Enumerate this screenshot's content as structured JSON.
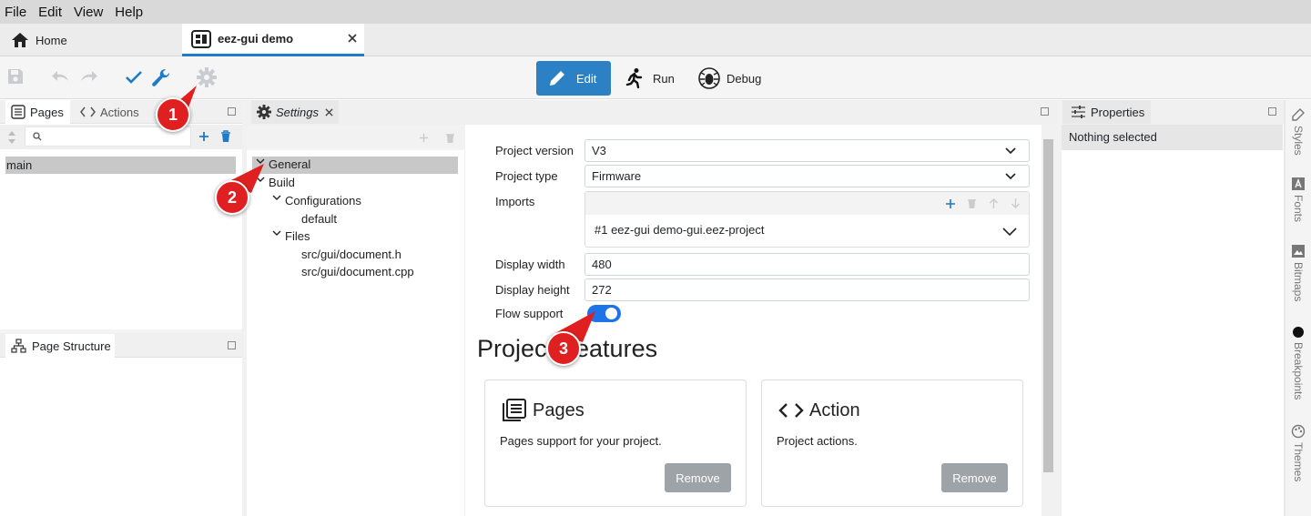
{
  "menu": [
    "File",
    "Edit",
    "View",
    "Help"
  ],
  "tabs": {
    "home": "Home",
    "project": "eez-gui demo"
  },
  "toolbar": {
    "edit": "Edit",
    "run": "Run",
    "debug": "Debug"
  },
  "left_panel": {
    "tab_pages": "Pages",
    "tab_actions": "Actions",
    "search_placeholder": "",
    "pages": [
      "main"
    ],
    "structure_title": "Page Structure"
  },
  "settings_panel": {
    "title": "Settings",
    "tree": {
      "general": "General",
      "build": "Build",
      "configurations": "Configurations",
      "default": "default",
      "files": "Files",
      "file1": "src/gui/document.h",
      "file2": "src/gui/document.cpp"
    }
  },
  "form": {
    "project_version_label": "Project version",
    "project_version_value": "V3",
    "project_type_label": "Project type",
    "project_type_value": "Firmware",
    "imports_label": "Imports",
    "import_item": "#1  eez-gui demo-gui.eez-project",
    "display_width_label": "Display width",
    "display_width_value": "480",
    "display_height_label": "Display height",
    "display_height_value": "272",
    "flow_support_label": "Flow support",
    "flow_support_on": true
  },
  "features": {
    "heading": "Project Features",
    "cards": [
      {
        "title": "Pages",
        "desc": "Pages support for your project.",
        "button": "Remove"
      },
      {
        "title": "Action",
        "desc": "Project actions.",
        "button": "Remove"
      }
    ]
  },
  "properties": {
    "title": "Properties",
    "empty": "Nothing selected"
  },
  "side_tabs": [
    "Styles",
    "Fonts",
    "Bitmaps",
    "Breakpoints",
    "Themes"
  ],
  "badges": [
    "1",
    "2",
    "3"
  ],
  "colors": {
    "accent": "#2c80c4",
    "toggle": "#1e73e8",
    "badge": "#e02020",
    "remove_button": "#9ea3a8"
  },
  "icons": [
    "home-icon",
    "dashboard-icon",
    "close-icon",
    "save-icon",
    "undo-icon",
    "redo-icon",
    "check-icon",
    "wrench-icon",
    "gear-icon",
    "pencil-icon",
    "run-icon",
    "bug-icon",
    "pages-icon",
    "code-icon",
    "search-icon",
    "plus-icon",
    "trash-icon",
    "sitemap-icon",
    "sliders-icon",
    "chevron-down-icon",
    "arrow-up-icon",
    "arrow-down-icon",
    "maximize-icon"
  ]
}
